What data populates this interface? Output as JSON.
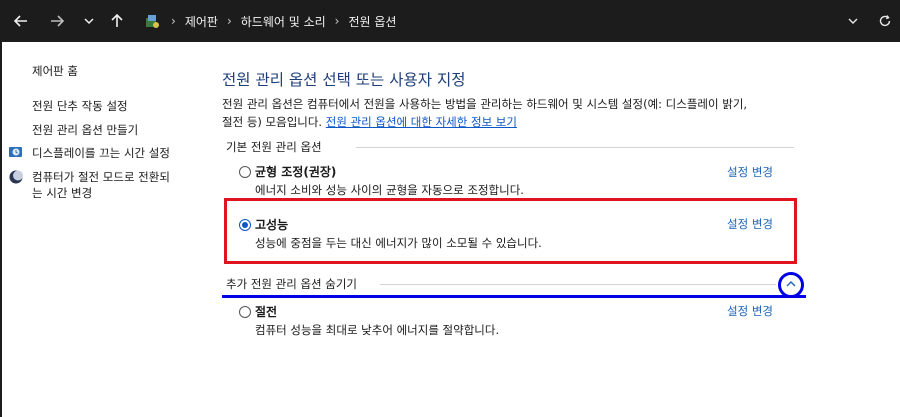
{
  "address_bar": {
    "breadcrumbs": [
      "제어판",
      "하드웨어 및 소리",
      "전원 옵션"
    ],
    "separator": "›"
  },
  "nav": {
    "back_icon": "arrow-left-icon",
    "forward_icon": "arrow-right-icon",
    "recent_icon": "chevron-down-icon",
    "up_icon": "arrow-up-icon",
    "dropdown_icon": "chevron-down-icon",
    "refresh_icon": "refresh-icon"
  },
  "sidebar": {
    "items": [
      {
        "label": "제어판 홈"
      },
      {
        "label": "전원 단추 작동 설정"
      },
      {
        "label": "전원 관리 옵션 만들기"
      },
      {
        "label": "디스플레이를 끄는 시간 설정",
        "icon": "clock-shield-icon"
      },
      {
        "label_line1": "컴퓨터가 절전 모드로 전환되",
        "label_line2": "는 시간 변경",
        "icon": "moon-icon"
      }
    ]
  },
  "main": {
    "title": "전원 관리 옵션 선택 또는 사용자 지정",
    "desc_line1": "전원 관리 옵션은 컴퓨터에서 전원을 사용하는 방법을 관리하는 하드웨어 및 시스템 설정(예: 디스플레이 밝기,",
    "desc_line2_text": "절전 등) 모음입니다.",
    "desc_link": "전원 관리 옵션에 대한 자세한 정보 보기",
    "group_basic": "기본 전원 관리 옵션",
    "group_extra": "추가 전원 관리 옵션 숨기기",
    "plans": [
      {
        "name": "균형 조정(권장)",
        "desc": "에너지 소비와 성능 사이의 균형을 자동으로 조정합니다.",
        "change": "설정 변경",
        "selected": false
      },
      {
        "name": "고성능",
        "desc": "성능에 중점을 두는 대신 에너지가 많이 소모될 수 있습니다.",
        "change": "설정 변경",
        "selected": true
      },
      {
        "name": "절전",
        "desc": "컴퓨터 성능을 최대로 낮추어 에너지를 절약합니다.",
        "change": "설정 변경",
        "selected": false
      }
    ],
    "highlight_colors": {
      "red": "#e0141e",
      "blue": "#0000e6"
    }
  }
}
